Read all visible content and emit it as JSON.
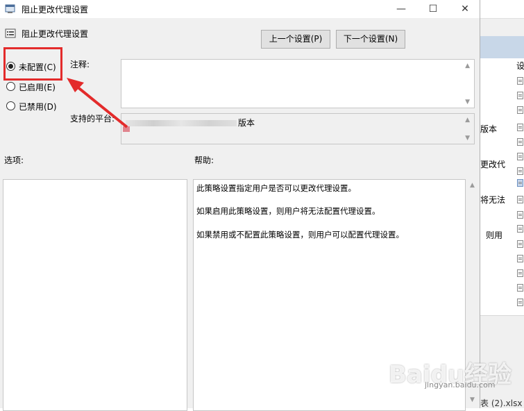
{
  "dialog": {
    "title": "阻止更改代理设置",
    "header_title": "阻止更改代理设置",
    "window_buttons": {
      "minimize": "—",
      "maximize": "☐",
      "close": "✕"
    },
    "prev_button": "上一个设置(P)",
    "next_button": "下一个设置(N)",
    "radios": [
      {
        "label": "未配置(C)",
        "checked": true
      },
      {
        "label": "已启用(E)",
        "checked": false
      },
      {
        "label": "已禁用(D)",
        "checked": false
      }
    ],
    "comment_label": "注释:",
    "comment_value": "",
    "platform_label": "支持的平台:",
    "platform_value_visible": "版本",
    "options_label": "选项:",
    "help_label": "帮助:",
    "help_lines": [
      "此策略设置指定用户是否可以更改代理设置。",
      "如果启用此策略设置，则用户将无法配置代理设置。",
      "如果禁用或不配置此策略设置，则用户可以配置代理设置。"
    ]
  },
  "background_window": {
    "header_fragment": "设",
    "fragments": [
      "版本",
      "更改代",
      "将无法",
      "则用"
    ],
    "file_fragment": "表 (2).xlsx"
  },
  "watermark": {
    "brand": "Baidu经验",
    "url": "jingyan.baidu.com"
  },
  "colors": {
    "annotation_red": "#e32b2b",
    "dialog_bg": "#f0f0f0"
  }
}
